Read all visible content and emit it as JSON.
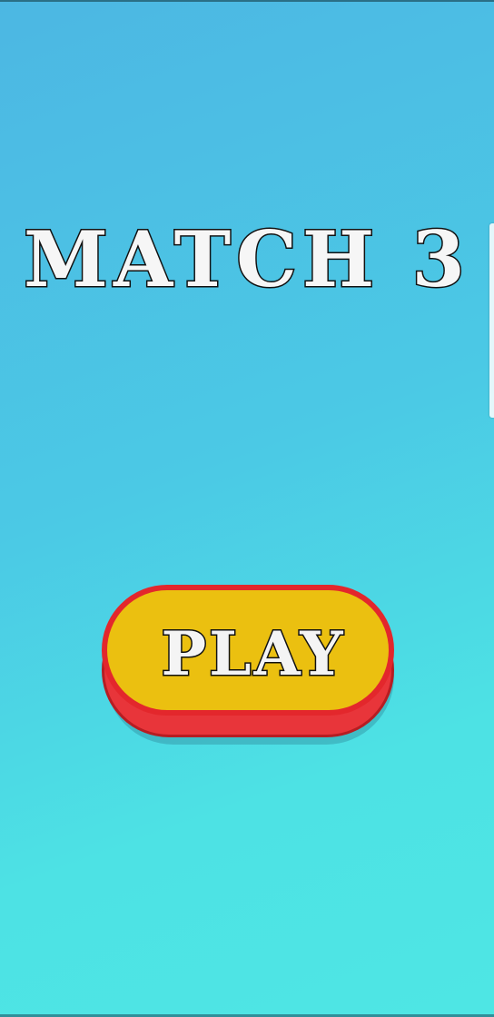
{
  "game": {
    "title": "MATCH 3",
    "play_label": "PLAY"
  },
  "colors": {
    "background_top": "#4cb7e3",
    "background_bottom": "#4ee6e4",
    "button_face": "#ebc010",
    "button_rim": "#e8353a",
    "text_fill": "#f6f6f6",
    "text_outline": "#111111"
  }
}
